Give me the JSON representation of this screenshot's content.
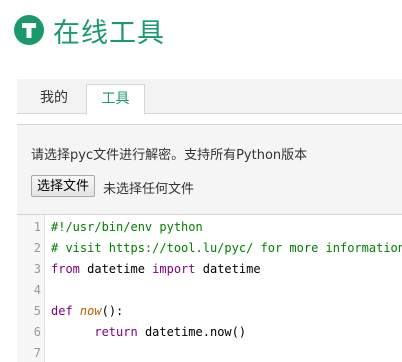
{
  "header": {
    "title": "在线工具",
    "logo_icon": "tool-logo-icon"
  },
  "tabs": [
    {
      "label": "我的",
      "active": false
    },
    {
      "label": "工具",
      "active": true
    }
  ],
  "panel": {
    "hint": "请选择pyc文件进行解密。支持所有Python版本",
    "file_button": "选择文件",
    "file_status": "未选择任何文件"
  },
  "editor": {
    "line_numbers": [
      "1",
      "2",
      "3",
      "4",
      "5",
      "6",
      "7"
    ],
    "lines": {
      "l1": "#!/usr/bin/env python",
      "l2": "# visit https://tool.lu/pyc/ for more information",
      "l3_kw_from": "from",
      "l3_mod": " datetime ",
      "l3_kw_import": "import",
      "l3_name": " datetime",
      "l5_kw_def": "def",
      "l5_space": " ",
      "l5_fn": "now",
      "l5_rest": "():",
      "l6_indent": "      ",
      "l6_kw_return": "return",
      "l6_rest": " datetime.now()"
    }
  },
  "colors": {
    "brand": "#1a9a6a",
    "comment": "#008000",
    "keyword": "#800080",
    "function": "#c06000"
  }
}
